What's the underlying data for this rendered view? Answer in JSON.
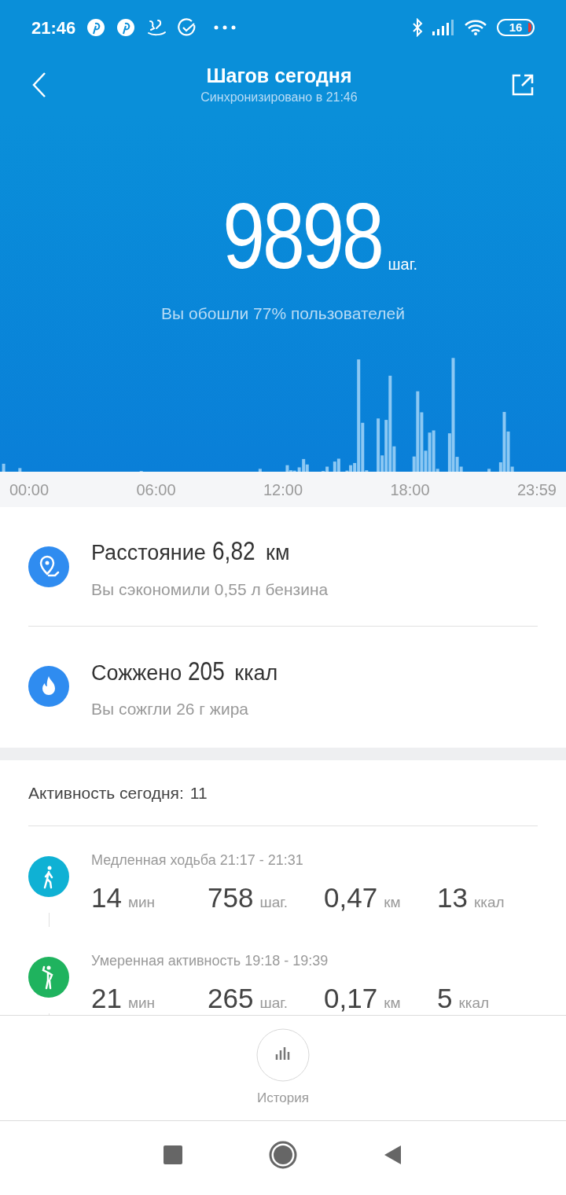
{
  "status_bar": {
    "time": "21:46",
    "battery": "16"
  },
  "header": {
    "title": "Шагов сегодня",
    "subtitle": "Синхронизировано в 21:46"
  },
  "summary": {
    "steps": "9898",
    "unit": "шаг.",
    "comparison": "Вы обошли 77% пользователей"
  },
  "axis_labels": [
    "00:00",
    "06:00",
    "12:00",
    "18:00",
    "23:59"
  ],
  "metrics": [
    {
      "kind": "distance",
      "label": "Расстояние",
      "value": "6,82",
      "unit": "км",
      "note": "Вы сэкономили 0,55 л бензина"
    },
    {
      "kind": "calories",
      "label": "Сожжено",
      "value": "205",
      "unit": "ккал",
      "note": "Вы сожгли 26 г жира"
    }
  ],
  "activity": {
    "label": "Активность сегодня:",
    "count": "11",
    "items": [
      {
        "kind": "walk",
        "color": "#0fb1d4",
        "title": "Медленная ходьба 21:17 - 21:31",
        "stats": [
          {
            "value": "14",
            "unit": "мин"
          },
          {
            "value": "758",
            "unit": "шаг."
          },
          {
            "value": "0,47",
            "unit": "км"
          },
          {
            "value": "13",
            "unit": "ккал"
          }
        ]
      },
      {
        "kind": "active",
        "color": "#1fb35e",
        "title": "Умеренная активность 19:18 - 19:39",
        "stats": [
          {
            "value": "21",
            "unit": "мин"
          },
          {
            "value": "265",
            "unit": "шаг."
          },
          {
            "value": "0,17",
            "unit": "км"
          },
          {
            "value": "5",
            "unit": "ккал"
          }
        ]
      }
    ]
  },
  "history_button": {
    "label": "История"
  }
}
